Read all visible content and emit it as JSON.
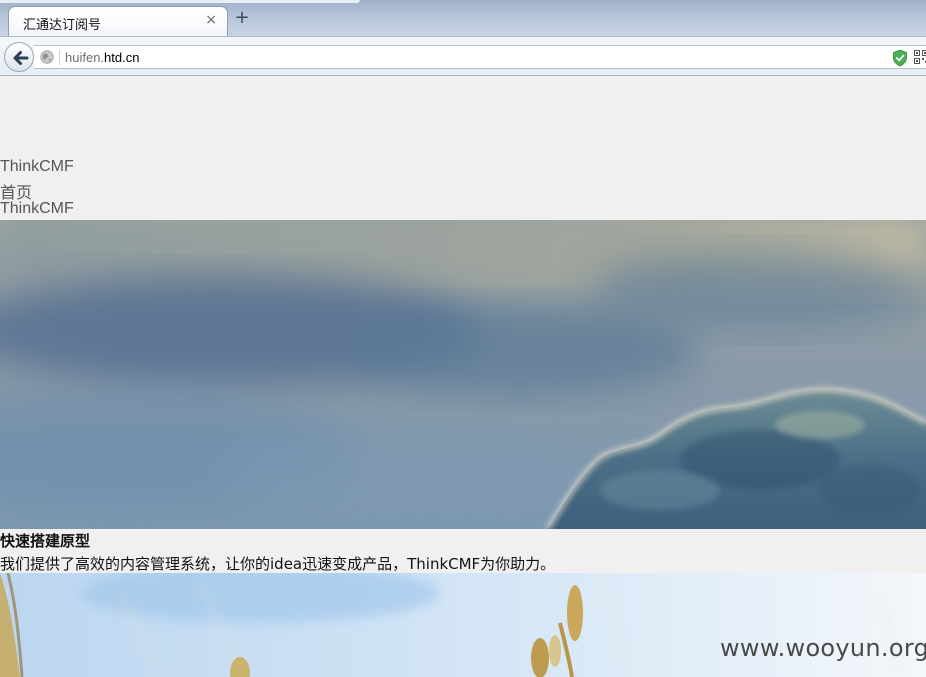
{
  "browser": {
    "tab_title": "汇通达订阅号",
    "tab_close_glyph": "×",
    "new_tab_glyph": "+",
    "url_prefix": "huifen.",
    "url_domain": "htd.cn",
    "icons": {
      "back": "back-arrow-icon",
      "site": "globe-icon",
      "security": "shield-check-icon",
      "qr": "qr-code-icon"
    },
    "colors": {
      "shield": "#4caf50",
      "back_arrow": "#2d3f55"
    }
  },
  "site": {
    "brand": "ThinkCMF",
    "nav": {
      "home": "首页"
    },
    "brand_footer": "ThinkCMF",
    "slider": {
      "caption_title": "快速搭建原型",
      "caption_text": "我们提供了高效的内容管理系统，让你的idea迅速变成产品，ThinkCMF为你助力。"
    }
  },
  "watermark": "www.wooyun.org"
}
